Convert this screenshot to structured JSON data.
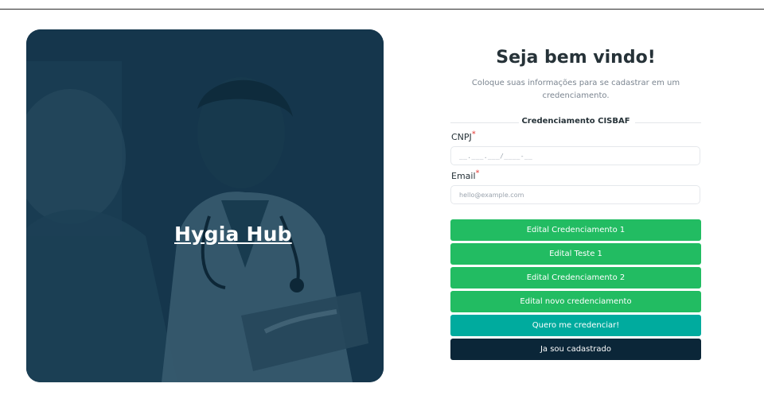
{
  "hero": {
    "title": "Hygia Hub"
  },
  "header": {
    "title": "Seja bem vindo!",
    "subtitle": "Coloque suas informações para se cadastrar em um credenciamento."
  },
  "section": {
    "label": "Credenciamento CISBAF"
  },
  "form": {
    "cnpj_label": "CNPJ",
    "cnpj_placeholder": "__.___.___/____-__",
    "email_label": "Email",
    "email_placeholder": "hello@example.com",
    "required_mark": "*"
  },
  "editais": [
    {
      "label": "Edital Credenciamento 1"
    },
    {
      "label": "Edital Teste 1"
    },
    {
      "label": "Edital Credenciamento 2"
    },
    {
      "label": "Edital novo credenciamento"
    }
  ],
  "actions": {
    "credenciar_label": "Quero me credenciar!",
    "cadastrado_label": "Ja sou cadastrado"
  },
  "colors": {
    "green": "#22bc62",
    "teal": "#00ab9e",
    "navy": "#0b2638",
    "hero_overlay": "#17394f"
  }
}
